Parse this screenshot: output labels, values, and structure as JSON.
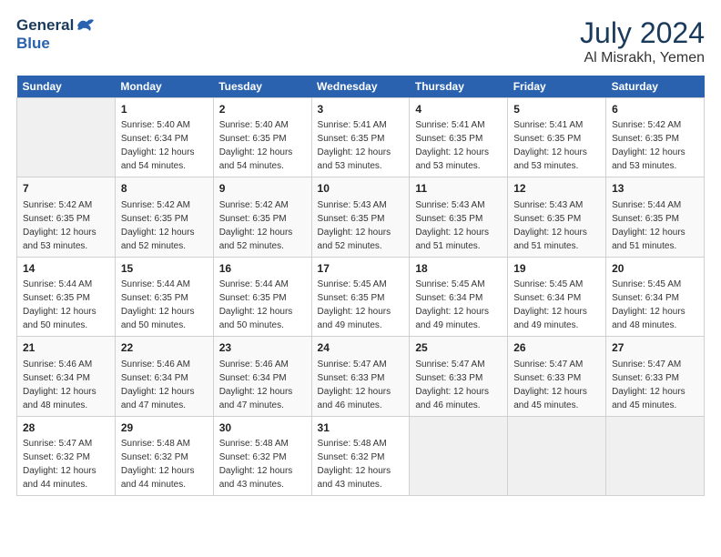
{
  "header": {
    "logo_general": "General",
    "logo_blue": "Blue",
    "month_year": "July 2024",
    "location": "Al Misrakh, Yemen"
  },
  "days_of_week": [
    "Sunday",
    "Monday",
    "Tuesday",
    "Wednesday",
    "Thursday",
    "Friday",
    "Saturday"
  ],
  "weeks": [
    [
      {
        "day": "",
        "sunrise": "",
        "sunset": "",
        "daylight": "",
        "empty": true
      },
      {
        "day": "1",
        "sunrise": "Sunrise: 5:40 AM",
        "sunset": "Sunset: 6:34 PM",
        "daylight": "Daylight: 12 hours and 54 minutes."
      },
      {
        "day": "2",
        "sunrise": "Sunrise: 5:40 AM",
        "sunset": "Sunset: 6:35 PM",
        "daylight": "Daylight: 12 hours and 54 minutes."
      },
      {
        "day": "3",
        "sunrise": "Sunrise: 5:41 AM",
        "sunset": "Sunset: 6:35 PM",
        "daylight": "Daylight: 12 hours and 53 minutes."
      },
      {
        "day": "4",
        "sunrise": "Sunrise: 5:41 AM",
        "sunset": "Sunset: 6:35 PM",
        "daylight": "Daylight: 12 hours and 53 minutes."
      },
      {
        "day": "5",
        "sunrise": "Sunrise: 5:41 AM",
        "sunset": "Sunset: 6:35 PM",
        "daylight": "Daylight: 12 hours and 53 minutes."
      },
      {
        "day": "6",
        "sunrise": "Sunrise: 5:42 AM",
        "sunset": "Sunset: 6:35 PM",
        "daylight": "Daylight: 12 hours and 53 minutes."
      }
    ],
    [
      {
        "day": "7",
        "sunrise": "Sunrise: 5:42 AM",
        "sunset": "Sunset: 6:35 PM",
        "daylight": "Daylight: 12 hours and 53 minutes."
      },
      {
        "day": "8",
        "sunrise": "Sunrise: 5:42 AM",
        "sunset": "Sunset: 6:35 PM",
        "daylight": "Daylight: 12 hours and 52 minutes."
      },
      {
        "day": "9",
        "sunrise": "Sunrise: 5:42 AM",
        "sunset": "Sunset: 6:35 PM",
        "daylight": "Daylight: 12 hours and 52 minutes."
      },
      {
        "day": "10",
        "sunrise": "Sunrise: 5:43 AM",
        "sunset": "Sunset: 6:35 PM",
        "daylight": "Daylight: 12 hours and 52 minutes."
      },
      {
        "day": "11",
        "sunrise": "Sunrise: 5:43 AM",
        "sunset": "Sunset: 6:35 PM",
        "daylight": "Daylight: 12 hours and 51 minutes."
      },
      {
        "day": "12",
        "sunrise": "Sunrise: 5:43 AM",
        "sunset": "Sunset: 6:35 PM",
        "daylight": "Daylight: 12 hours and 51 minutes."
      },
      {
        "day": "13",
        "sunrise": "Sunrise: 5:44 AM",
        "sunset": "Sunset: 6:35 PM",
        "daylight": "Daylight: 12 hours and 51 minutes."
      }
    ],
    [
      {
        "day": "14",
        "sunrise": "Sunrise: 5:44 AM",
        "sunset": "Sunset: 6:35 PM",
        "daylight": "Daylight: 12 hours and 50 minutes."
      },
      {
        "day": "15",
        "sunrise": "Sunrise: 5:44 AM",
        "sunset": "Sunset: 6:35 PM",
        "daylight": "Daylight: 12 hours and 50 minutes."
      },
      {
        "day": "16",
        "sunrise": "Sunrise: 5:44 AM",
        "sunset": "Sunset: 6:35 PM",
        "daylight": "Daylight: 12 hours and 50 minutes."
      },
      {
        "day": "17",
        "sunrise": "Sunrise: 5:45 AM",
        "sunset": "Sunset: 6:35 PM",
        "daylight": "Daylight: 12 hours and 49 minutes."
      },
      {
        "day": "18",
        "sunrise": "Sunrise: 5:45 AM",
        "sunset": "Sunset: 6:34 PM",
        "daylight": "Daylight: 12 hours and 49 minutes."
      },
      {
        "day": "19",
        "sunrise": "Sunrise: 5:45 AM",
        "sunset": "Sunset: 6:34 PM",
        "daylight": "Daylight: 12 hours and 49 minutes."
      },
      {
        "day": "20",
        "sunrise": "Sunrise: 5:45 AM",
        "sunset": "Sunset: 6:34 PM",
        "daylight": "Daylight: 12 hours and 48 minutes."
      }
    ],
    [
      {
        "day": "21",
        "sunrise": "Sunrise: 5:46 AM",
        "sunset": "Sunset: 6:34 PM",
        "daylight": "Daylight: 12 hours and 48 minutes."
      },
      {
        "day": "22",
        "sunrise": "Sunrise: 5:46 AM",
        "sunset": "Sunset: 6:34 PM",
        "daylight": "Daylight: 12 hours and 47 minutes."
      },
      {
        "day": "23",
        "sunrise": "Sunrise: 5:46 AM",
        "sunset": "Sunset: 6:34 PM",
        "daylight": "Daylight: 12 hours and 47 minutes."
      },
      {
        "day": "24",
        "sunrise": "Sunrise: 5:47 AM",
        "sunset": "Sunset: 6:33 PM",
        "daylight": "Daylight: 12 hours and 46 minutes."
      },
      {
        "day": "25",
        "sunrise": "Sunrise: 5:47 AM",
        "sunset": "Sunset: 6:33 PM",
        "daylight": "Daylight: 12 hours and 46 minutes."
      },
      {
        "day": "26",
        "sunrise": "Sunrise: 5:47 AM",
        "sunset": "Sunset: 6:33 PM",
        "daylight": "Daylight: 12 hours and 45 minutes."
      },
      {
        "day": "27",
        "sunrise": "Sunrise: 5:47 AM",
        "sunset": "Sunset: 6:33 PM",
        "daylight": "Daylight: 12 hours and 45 minutes."
      }
    ],
    [
      {
        "day": "28",
        "sunrise": "Sunrise: 5:47 AM",
        "sunset": "Sunset: 6:32 PM",
        "daylight": "Daylight: 12 hours and 44 minutes."
      },
      {
        "day": "29",
        "sunrise": "Sunrise: 5:48 AM",
        "sunset": "Sunset: 6:32 PM",
        "daylight": "Daylight: 12 hours and 44 minutes."
      },
      {
        "day": "30",
        "sunrise": "Sunrise: 5:48 AM",
        "sunset": "Sunset: 6:32 PM",
        "daylight": "Daylight: 12 hours and 43 minutes."
      },
      {
        "day": "31",
        "sunrise": "Sunrise: 5:48 AM",
        "sunset": "Sunset: 6:32 PM",
        "daylight": "Daylight: 12 hours and 43 minutes."
      },
      {
        "day": "",
        "sunrise": "",
        "sunset": "",
        "daylight": "",
        "empty": true
      },
      {
        "day": "",
        "sunrise": "",
        "sunset": "",
        "daylight": "",
        "empty": true
      },
      {
        "day": "",
        "sunrise": "",
        "sunset": "",
        "daylight": "",
        "empty": true
      }
    ]
  ]
}
